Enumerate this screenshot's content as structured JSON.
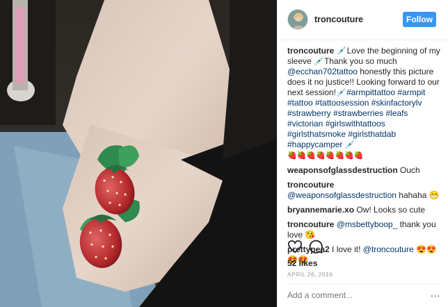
{
  "header": {
    "username": "troncouture",
    "follow_label": "Follow"
  },
  "caption": {
    "username": "troncouture",
    "text_1": " 💉Love the beginning of my sleeve 💉Thank you so much ",
    "mention": "@ecchan702tattoo",
    "text_2": " honestly this picture does it no justice!! Looking forward to our next session!💉",
    "hashtags": "#armpittattoo #armpit #tattoo #tattoosession #skinfactorylv #strawberry #strawberries #leafs #victorian #girlswithtattoos #girlsthatsmoke #girlsthatdab #happycamper",
    "emoji_tail": " 💉",
    "strawberries": "🍓🍓🍓🍓🍓🍓🍓🍓"
  },
  "comments": [
    {
      "username": "weaponsofglassdestruction",
      "text": "Ouch"
    },
    {
      "username": "troncouture",
      "mention": "@weaponsofglassdestruction",
      "text": " hahaha 😁"
    },
    {
      "username": "bryannemarie.xo",
      "text": "Ow! Looks so cute"
    },
    {
      "username": "troncouture",
      "mention": "@msbettyboop_",
      "text": " thank you love 😘"
    },
    {
      "username": "prettypea2",
      "text": "I love it! ",
      "mention": "@troncouture",
      "text_2": " 😍😍😍😍"
    }
  ],
  "actions": {
    "like_icon": "heart-icon",
    "comment_icon": "comment-icon"
  },
  "likes": "52 likes",
  "date": "APRIL 26, 2016",
  "add_comment_placeholder": "Add a comment...",
  "more_label": "..."
}
